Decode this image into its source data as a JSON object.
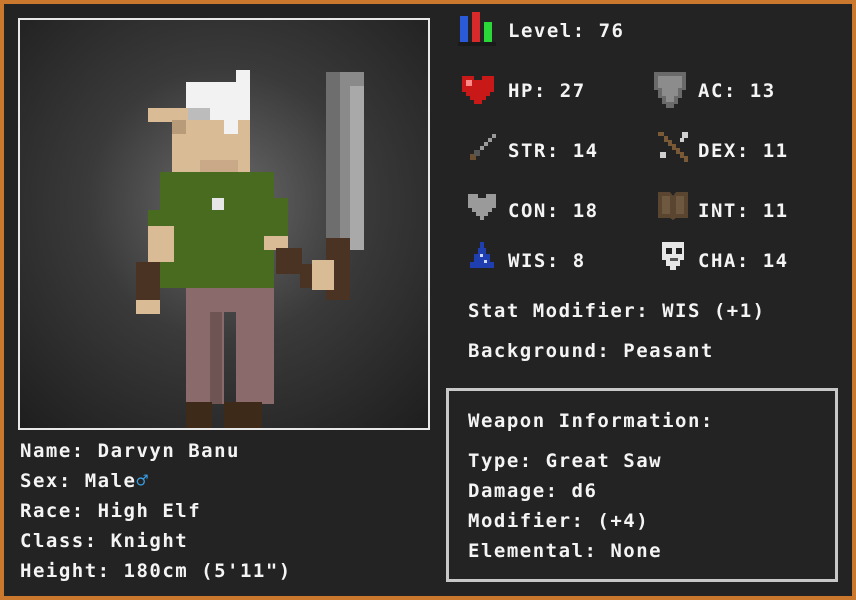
{
  "character": {
    "name_line": "Name: Darvyn Banu",
    "sex_label": "Sex: Male",
    "sex_symbol": "♂",
    "race_line": "Race: High Elf",
    "class_line": "Class: Knight",
    "height_line": "Height: 180cm (5'11\")"
  },
  "stats": {
    "level": "Level: 76",
    "hp": "HP: 27",
    "ac": "AC: 13",
    "str": "STR: 14",
    "dex": "DEX: 11",
    "con": "CON: 18",
    "int": "INT: 11",
    "wis": "WIS: 8",
    "cha": "CHA: 14",
    "stat_modifier": "Stat Modifier: WIS (+1)",
    "background": "Background: Peasant"
  },
  "weapon": {
    "heading": "Weapon Information:",
    "type": "Type: Great Saw",
    "damage": "Damage: d6",
    "modifier": "Modifier: (+4)",
    "elemental": "Elemental: None"
  },
  "icons": {
    "level": "bar-chart-icon",
    "hp": "heart-icon",
    "ac": "shield-icon",
    "str": "sword-icon",
    "dex": "bow-icon",
    "con": "grey-heart-icon",
    "int": "book-icon",
    "wis": "wizard-hat-icon",
    "cha": "mask-icon"
  },
  "colors": {
    "frame_border": "#c9782e",
    "background": "#232323",
    "text": "#f4f4f4",
    "male_symbol": "#3aa0e8"
  }
}
